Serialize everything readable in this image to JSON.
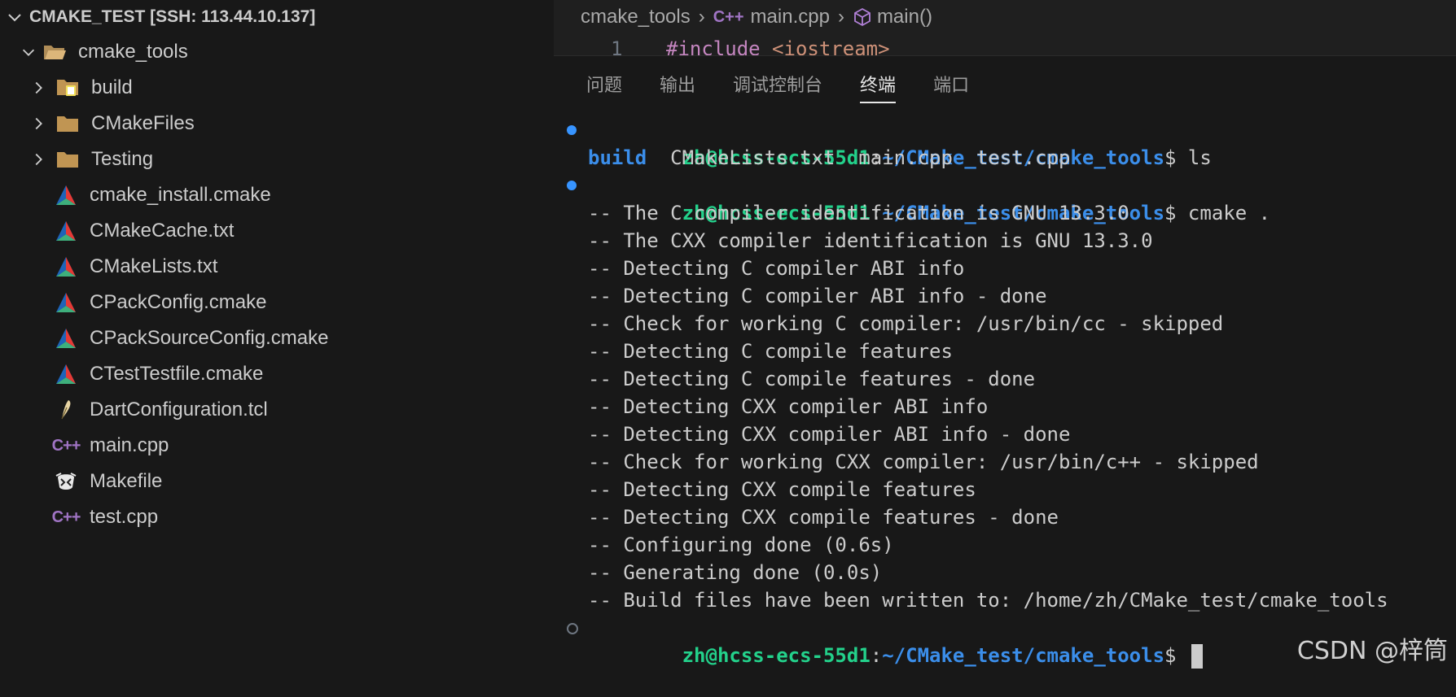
{
  "explorer": {
    "title": "CMAKE_TEST [SSH: 113.44.10.137]",
    "root_folder": "cmake_tools",
    "items": [
      {
        "label": "build",
        "kind": "folder-build"
      },
      {
        "label": "CMakeFiles",
        "kind": "folder"
      },
      {
        "label": "Testing",
        "kind": "folder"
      },
      {
        "label": "cmake_install.cmake",
        "kind": "cmake"
      },
      {
        "label": "CMakeCache.txt",
        "kind": "cmake"
      },
      {
        "label": "CMakeLists.txt",
        "kind": "cmake"
      },
      {
        "label": "CPackConfig.cmake",
        "kind": "cmake"
      },
      {
        "label": "CPackSourceConfig.cmake",
        "kind": "cmake"
      },
      {
        "label": "CTestTestfile.cmake",
        "kind": "cmake"
      },
      {
        "label": "DartConfiguration.tcl",
        "kind": "tcl"
      },
      {
        "label": "main.cpp",
        "kind": "cpp"
      },
      {
        "label": "Makefile",
        "kind": "makefile"
      },
      {
        "label": "test.cpp",
        "kind": "cpp"
      }
    ]
  },
  "breadcrumb": {
    "folder": "cmake_tools",
    "file": "main.cpp",
    "symbol": "main()",
    "cpp_glyph": "C++"
  },
  "editor": {
    "line_number": "1",
    "directive": "#include",
    "header": " <iostream>"
  },
  "panel": {
    "tabs": [
      "问题",
      "输出",
      "调试控制台",
      "终端",
      "端口"
    ],
    "active_tab": "终端"
  },
  "terminal": {
    "user_host": "zh@hcss-ecs-55d1",
    "path": "~/CMake_test/cmake_tools",
    "cmd1": "ls",
    "ls_dir": "build",
    "ls_files": "  CMakeLists.txt  main.cpp  test.cpp",
    "cmd2": "cmake .",
    "output": [
      "-- The C compiler identification is GNU 13.3.0",
      "-- The CXX compiler identification is GNU 13.3.0",
      "-- Detecting C compiler ABI info",
      "-- Detecting C compiler ABI info - done",
      "-- Check for working C compiler: /usr/bin/cc - skipped",
      "-- Detecting C compile features",
      "-- Detecting C compile features - done",
      "-- Detecting CXX compiler ABI info",
      "-- Detecting CXX compiler ABI info - done",
      "-- Check for working CXX compiler: /usr/bin/c++ - skipped",
      "-- Detecting CXX compile features",
      "-- Detecting CXX compile features - done",
      "-- Configuring done (0.6s)",
      "-- Generating done (0.0s)",
      "-- Build files have been written to: /home/zh/CMake_test/cmake_tools"
    ]
  },
  "watermark": "CSDN @梓筒",
  "colors": {
    "user": "#23d18b",
    "path": "#3b8eea",
    "cpp_icon": "#a074c4"
  }
}
